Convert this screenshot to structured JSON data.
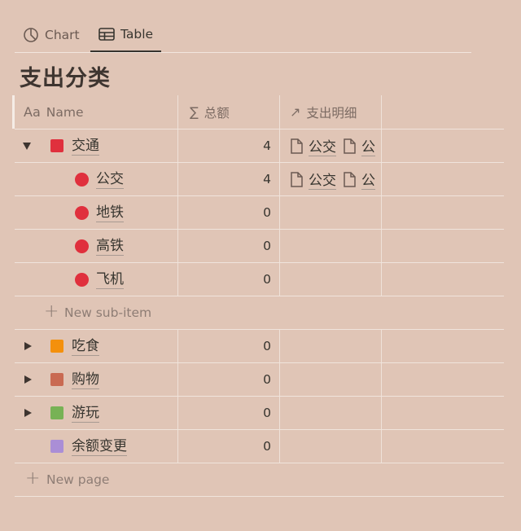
{
  "tabs": [
    {
      "label": "Chart",
      "icon": "pie-chart-icon",
      "active": false
    },
    {
      "label": "Table",
      "icon": "table-icon",
      "active": true
    }
  ],
  "title": "支出分类",
  "columns": {
    "name": {
      "icon": "Aa",
      "label": "Name"
    },
    "total": {
      "icon": "∑",
      "label": "总额"
    },
    "detail": {
      "icon": "↗",
      "label": "支出明细"
    }
  },
  "rows": [
    {
      "label": "交通",
      "total": "4",
      "color": "#e0303d",
      "expanded": true,
      "pages": [
        "公交",
        "公"
      ]
    },
    {
      "label": "公交",
      "total": "4",
      "color": "#e0303d",
      "sub": true,
      "pages": [
        "公交",
        "公"
      ]
    },
    {
      "label": "地铁",
      "total": "0",
      "color": "#e0303d",
      "sub": true
    },
    {
      "label": "高铁",
      "total": "0",
      "color": "#e0303d",
      "sub": true
    },
    {
      "label": "飞机",
      "total": "0",
      "color": "#e0303d",
      "sub": true
    },
    {
      "label": "吃食",
      "total": "0",
      "color": "#f4900c"
    },
    {
      "label": "购物",
      "total": "0",
      "color": "#c96a52"
    },
    {
      "label": "游玩",
      "total": "0",
      "color": "#77b255"
    },
    {
      "label": "余额变更",
      "total": "0",
      "color": "#aa8ed6"
    }
  ],
  "new_sub_item": "New sub-item",
  "new_page": "New page"
}
